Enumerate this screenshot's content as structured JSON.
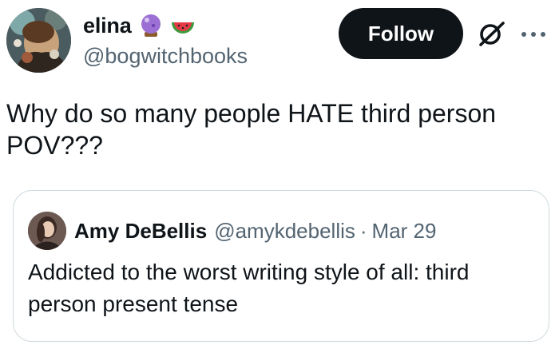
{
  "author": {
    "display_name": "elina",
    "name_emojis": [
      "crystal-ball-emoji",
      "watermelon-emoji"
    ],
    "handle": "@bogwitchbooks"
  },
  "actions": {
    "follow_label": "Follow",
    "grok_icon": "grok-icon",
    "more_icon": "more-icon"
  },
  "tweet": {
    "text": "Why do so many people HATE third person\nPOV???"
  },
  "quote": {
    "display_name": "Amy DeBellis",
    "handle": "@amykdebellis",
    "separator": "·",
    "date": "Mar 29",
    "text": "Addicted to the worst writing style of all: third\nperson present tense"
  },
  "colors": {
    "text": "#0f1419",
    "muted": "#536471",
    "button_bg": "#0f1419",
    "button_text": "#ffffff",
    "card_border": "#cfd9de"
  }
}
